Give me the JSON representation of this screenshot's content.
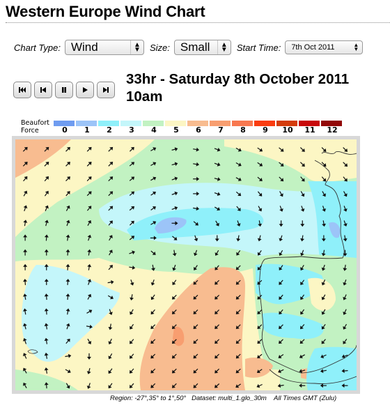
{
  "page": {
    "title": "Western Europe Wind Chart"
  },
  "controls": {
    "chart_type_label": "Chart Type:",
    "chart_type_value": "Wind",
    "size_label": "Size:",
    "size_value": "Small",
    "start_time_label": "Start Time:",
    "start_time_value": "7th Oct 2011"
  },
  "player": {
    "buttons": [
      {
        "name": "first-frame",
        "icon": "skip-to-start-icon"
      },
      {
        "name": "previous-frame",
        "icon": "step-back-icon"
      },
      {
        "name": "pause",
        "icon": "pause-icon"
      },
      {
        "name": "play",
        "icon": "play-icon"
      },
      {
        "name": "next-frame",
        "icon": "step-forward-icon"
      }
    ]
  },
  "timestamp": "33hr - Saturday 8th October 2011 10am",
  "legend": {
    "label_line1": "Beaufort",
    "label_line2": "Force",
    "levels": [
      {
        "force": "0",
        "color": "#6f9cf0"
      },
      {
        "force": "1",
        "color": "#9cc4f8"
      },
      {
        "force": "2",
        "color": "#8ff0fa"
      },
      {
        "force": "3",
        "color": "#c4f6fa"
      },
      {
        "force": "4",
        "color": "#c2f2c2"
      },
      {
        "force": "5",
        "color": "#fcf6c4"
      },
      {
        "force": "6",
        "color": "#f8bc90"
      },
      {
        "force": "7",
        "color": "#f89e70"
      },
      {
        "force": "8",
        "color": "#f87850"
      },
      {
        "force": "9",
        "color": "#fa3c10"
      },
      {
        "force": "10",
        "color": "#d43c0c"
      },
      {
        "force": "11",
        "color": "#c8080a"
      },
      {
        "force": "12",
        "color": "#920808"
      }
    ]
  },
  "map": {
    "region_west_lon": -27,
    "region_south_lat": 35,
    "region_east_lon": 1,
    "region_north_lat": 50,
    "arrow_grid_cols": 16,
    "arrow_grid_rows": 17,
    "wind_direction_deg_rows": [
      [
        45,
        45,
        45,
        45,
        45,
        45,
        60,
        75,
        100,
        110,
        120,
        125,
        130,
        135,
        135,
        135
      ],
      [
        45,
        45,
        45,
        45,
        45,
        50,
        60,
        75,
        100,
        110,
        120,
        125,
        130,
        135,
        135,
        135
      ],
      [
        40,
        40,
        45,
        45,
        45,
        50,
        60,
        70,
        90,
        105,
        120,
        130,
        135,
        140,
        140,
        140
      ],
      [
        30,
        35,
        40,
        45,
        45,
        50,
        55,
        70,
        90,
        110,
        130,
        140,
        150,
        150,
        150,
        150
      ],
      [
        20,
        25,
        30,
        40,
        45,
        50,
        55,
        70,
        100,
        120,
        140,
        150,
        160,
        160,
        160,
        160
      ],
      [
        10,
        15,
        20,
        30,
        40,
        45,
        60,
        90,
        130,
        150,
        160,
        170,
        180,
        180,
        170,
        160
      ],
      [
        0,
        5,
        10,
        20,
        30,
        50,
        90,
        130,
        160,
        180,
        190,
        195,
        200,
        190,
        180,
        170
      ],
      [
        0,
        0,
        5,
        10,
        30,
        70,
        130,
        170,
        200,
        210,
        215,
        215,
        210,
        200,
        190,
        180
      ],
      [
        0,
        0,
        5,
        10,
        40,
        100,
        170,
        200,
        215,
        220,
        225,
        220,
        215,
        210,
        200,
        190
      ],
      [
        355,
        0,
        5,
        20,
        80,
        160,
        200,
        215,
        225,
        225,
        225,
        225,
        220,
        215,
        205,
        200
      ],
      [
        350,
        355,
        5,
        30,
        120,
        190,
        215,
        225,
        225,
        225,
        225,
        225,
        220,
        215,
        210,
        205
      ],
      [
        350,
        355,
        10,
        60,
        160,
        210,
        220,
        225,
        225,
        225,
        225,
        225,
        220,
        215,
        210,
        205
      ],
      [
        345,
        350,
        20,
        100,
        190,
        215,
        225,
        225,
        225,
        225,
        225,
        225,
        225,
        220,
        215,
        210
      ],
      [
        340,
        350,
        40,
        150,
        205,
        220,
        225,
        225,
        225,
        225,
        225,
        225,
        225,
        225,
        220,
        215
      ],
      [
        335,
        350,
        80,
        180,
        210,
        220,
        225,
        225,
        225,
        225,
        225,
        230,
        235,
        240,
        245,
        250
      ],
      [
        330,
        350,
        120,
        195,
        215,
        222,
        225,
        225,
        225,
        225,
        228,
        235,
        245,
        255,
        260,
        265
      ],
      [
        330,
        355,
        150,
        200,
        215,
        222,
        225,
        225,
        225,
        228,
        235,
        245,
        260,
        270,
        270,
        270
      ]
    ]
  },
  "caption": "Region: -27°,35° to 1°,50°   Dataset: multi_1.glo_30m    All Times GMT (Zulu)"
}
